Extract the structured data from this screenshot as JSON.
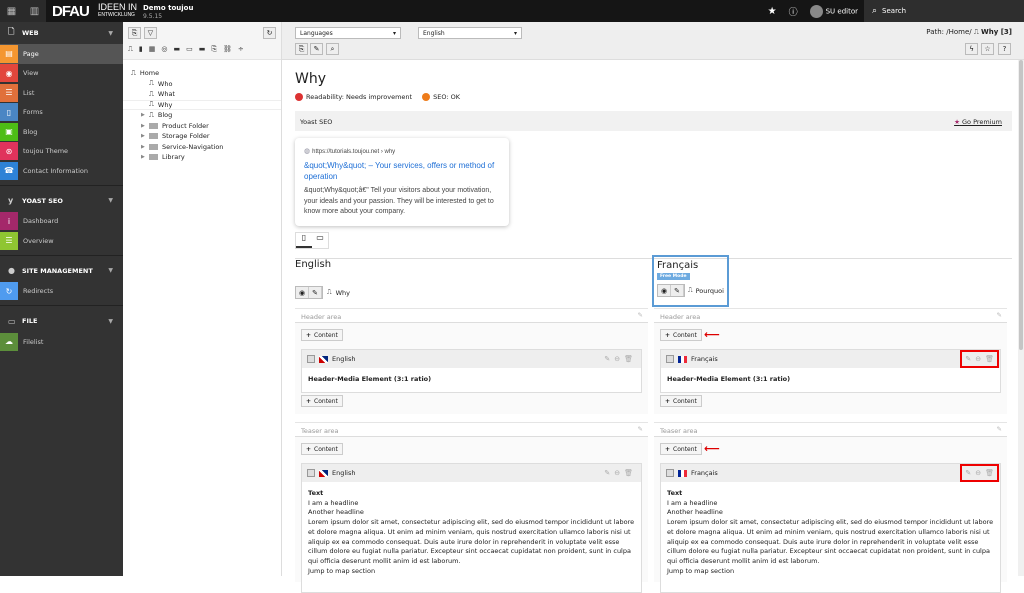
{
  "topbar": {
    "site": "Demo toujou",
    "version": "9.5.15",
    "logo": "DFAU",
    "logo_sub1": "IDEEN IN",
    "logo_sub2": "ENTWICKLUNG",
    "user": "SU editor",
    "search": "Search"
  },
  "sidebar": {
    "web": {
      "label": "WEB",
      "items": [
        {
          "label": "Page",
          "color": "#f49630",
          "icon": "page-icon"
        },
        {
          "label": "View",
          "color": "#e2463c",
          "icon": "eye-icon"
        },
        {
          "label": "List",
          "color": "#e0703b",
          "icon": "list-icon"
        },
        {
          "label": "Forms",
          "color": "#4a86c4",
          "icon": "forms-icon"
        },
        {
          "label": "Blog",
          "color": "#4dbd16",
          "icon": "blog-icon"
        },
        {
          "label": "toujou Theme",
          "color": "#e0335c",
          "icon": "fingerprint-icon"
        },
        {
          "label": "Contact Information",
          "color": "#2e82d6",
          "icon": "contact-icon"
        }
      ]
    },
    "yoast": {
      "label": "YOAST SEO",
      "items": [
        {
          "label": "Dashboard",
          "color": "#a4286a",
          "icon": "info-icon"
        },
        {
          "label": "Overview",
          "color": "#8fc632",
          "icon": "overview-icon"
        }
      ]
    },
    "site": {
      "label": "SITE MANAGEMENT",
      "items": [
        {
          "label": "Redirects",
          "color": "#4f9bef",
          "icon": "redirect-icon"
        }
      ]
    },
    "file": {
      "label": "FILE",
      "items": [
        {
          "label": "Filelist",
          "color": "#5c8e3b",
          "icon": "cloud-icon"
        }
      ]
    }
  },
  "tree": {
    "root": "Home",
    "children": [
      "Who",
      "What",
      "Why"
    ],
    "siblings": [
      "Blog",
      "Product Folder",
      "Storage Folder",
      "Service-Navigation",
      "Library"
    ]
  },
  "docheader": {
    "languages_select": "Languages",
    "language_select": "English",
    "path_prefix": "Path: /Home/",
    "path_page": "Why [3]"
  },
  "page": {
    "title": "Why",
    "readability": "Readability: Needs improvement",
    "seo": "SEO: OK",
    "yoast_label": "Yoast SEO",
    "go_premium": "Go Premium",
    "snippet": {
      "url": "https://tutorials.toujou.net › why",
      "title": "&quot;Why&quot; – Your services, offers or method of operation",
      "desc": "&quot;Why&quot;â€\" Tell your visitors about your motivation, your ideals and your passion. They will be interested to get to know more about your company."
    }
  },
  "columns": [
    {
      "lang": "English",
      "page": "Why",
      "flag": "english",
      "header_area": "Header area",
      "teaser_area": "Teaser area",
      "add": "Content",
      "ce1_title": "Header-Media Element (3:1 ratio)",
      "ce2_type": "Text",
      "ce2_h1": "I am a headline",
      "ce2_h2": "Another headline",
      "ce2_body": "Lorem ipsum dolor sit amet, consectetur adipiscing elit, sed do eiusmod tempor incididunt ut labore et dolore magna aliqua. Ut enim ad minim veniam, quis nostrud exercitation ullamco laboris nisi ut aliquip ex ea commodo consequat. Duis aute irure dolor in reprehenderit in voluptate velit esse cillum dolore eu fugiat nulla pariatur. Excepteur sint occaecat cupidatat non proident, sunt in culpa qui officia deserunt mollit anim id est laborum.",
      "ce2_link": "Jump to map section"
    },
    {
      "lang": "Français",
      "badge": "Free Mode",
      "page": "Pourquoi",
      "flag": "french",
      "header_area": "Header area",
      "teaser_area": "Teaser area",
      "add": "Content",
      "ce1_title": "Header-Media Element (3:1 ratio)",
      "ce2_type": "Text",
      "ce2_h1": "I am a headline",
      "ce2_h2": "Another headline",
      "ce2_body": "Lorem ipsum dolor sit amet, consectetur adipiscing elit, sed do eiusmod tempor incididunt ut labore et dolore magna aliqua. Ut enim ad minim veniam, quis nostrud exercitation ullamco laboris nisi ut aliquip ex ea commodo consequat. Duis aute irure dolor in reprehenderit in voluptate velit esse cillum dolore eu fugiat nulla pariatur. Excepteur sint occaecat cupidatat non proident, sunt in culpa qui officia deserunt mollit anim id est laborum.",
      "ce2_link": "Jump to map section"
    }
  ]
}
